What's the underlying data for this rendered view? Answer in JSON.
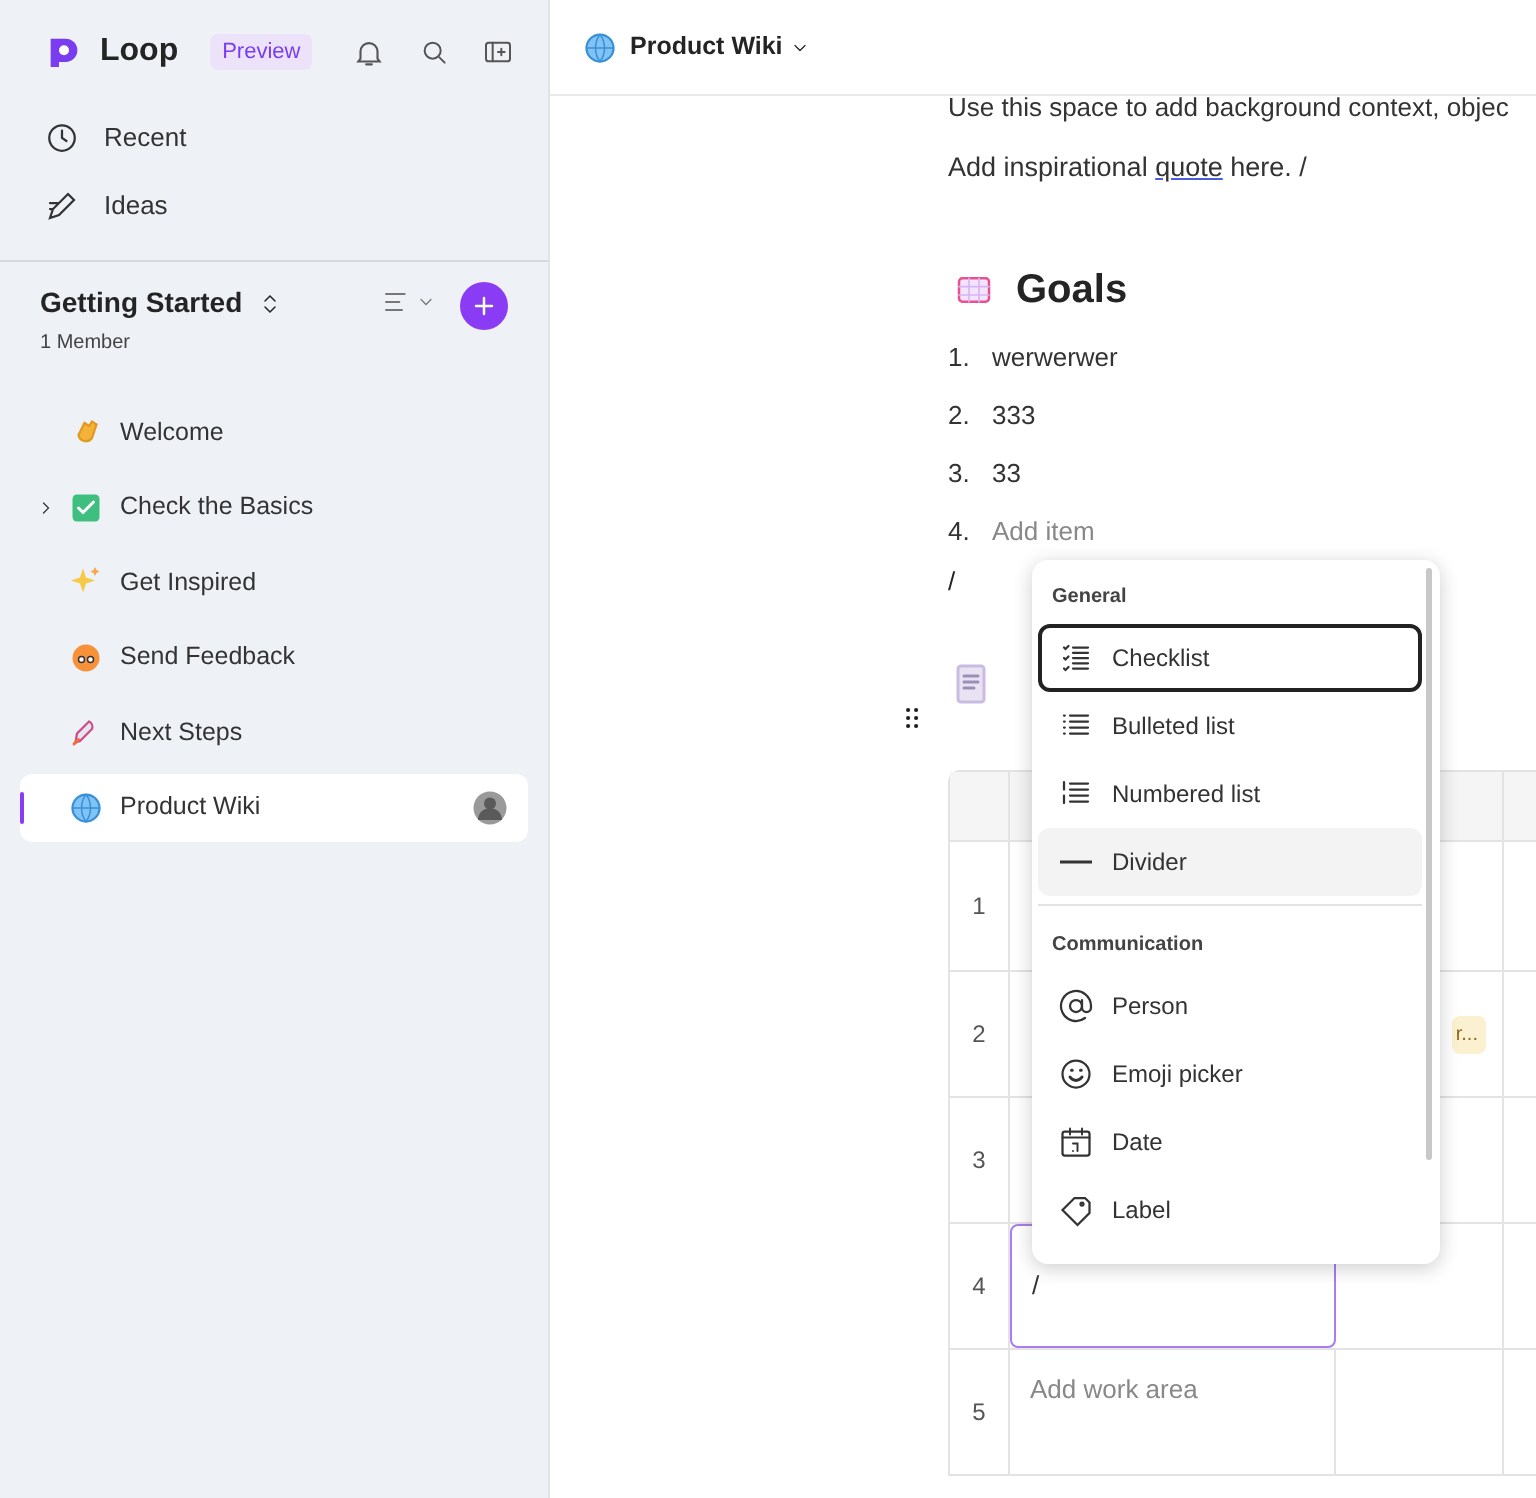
{
  "app": {
    "name": "Loop",
    "badge": "Preview"
  },
  "nav": [
    {
      "label": "Recent"
    },
    {
      "label": "Ideas"
    }
  ],
  "workspace": {
    "title": "Getting Started",
    "members": "1 Member"
  },
  "pages": [
    {
      "label": "Welcome",
      "selected": false,
      "expandable": false
    },
    {
      "label": "Check the Basics",
      "selected": false,
      "expandable": true
    },
    {
      "label": "Get Inspired",
      "selected": false,
      "expandable": false
    },
    {
      "label": "Send Feedback",
      "selected": false,
      "expandable": false
    },
    {
      "label": "Next Steps",
      "selected": false,
      "expandable": false
    },
    {
      "label": "Product Wiki",
      "selected": true,
      "expandable": false
    }
  ],
  "header": {
    "title": "Product Wiki"
  },
  "document": {
    "intro": "Use this space to add background context, objec",
    "quote_before": "Add inspirational",
    "quote_link": "quote",
    "quote_after": "here. /",
    "goals_title": "Goals",
    "goals": [
      {
        "number": "1.",
        "text": "werwerwer",
        "placeholder": false
      },
      {
        "number": "2.",
        "text": "333",
        "placeholder": false
      },
      {
        "number": "3.",
        "text": "33",
        "placeholder": false
      },
      {
        "number": "4.",
        "text": "Add item",
        "placeholder": true
      }
    ],
    "slash": "/"
  },
  "table": {
    "rows": [
      {
        "number": "1"
      },
      {
        "number": "2",
        "tag": "r..."
      },
      {
        "number": "3"
      },
      {
        "number": "4",
        "cell": "/",
        "editing": true,
        "placeholder": false
      },
      {
        "number": "5",
        "cell": "Add work area",
        "editing": false,
        "placeholder": true
      }
    ]
  },
  "menu": [
    {
      "kind": "section",
      "label": "General"
    },
    {
      "kind": "item",
      "label": "Checklist",
      "selected": true,
      "hovered": false
    },
    {
      "kind": "item",
      "label": "Bulleted list",
      "selected": false,
      "hovered": false
    },
    {
      "kind": "item",
      "label": "Numbered list",
      "selected": false,
      "hovered": false
    },
    {
      "kind": "item",
      "label": "Divider",
      "selected": false,
      "hovered": true
    },
    {
      "kind": "section",
      "label": "Communication"
    },
    {
      "kind": "item",
      "label": "Person",
      "selected": false,
      "hovered": false
    },
    {
      "kind": "item",
      "label": "Emoji picker",
      "selected": false,
      "hovered": false
    },
    {
      "kind": "item",
      "label": "Date",
      "selected": false,
      "hovered": false
    },
    {
      "kind": "item",
      "label": "Label",
      "selected": false,
      "hovered": false
    }
  ]
}
